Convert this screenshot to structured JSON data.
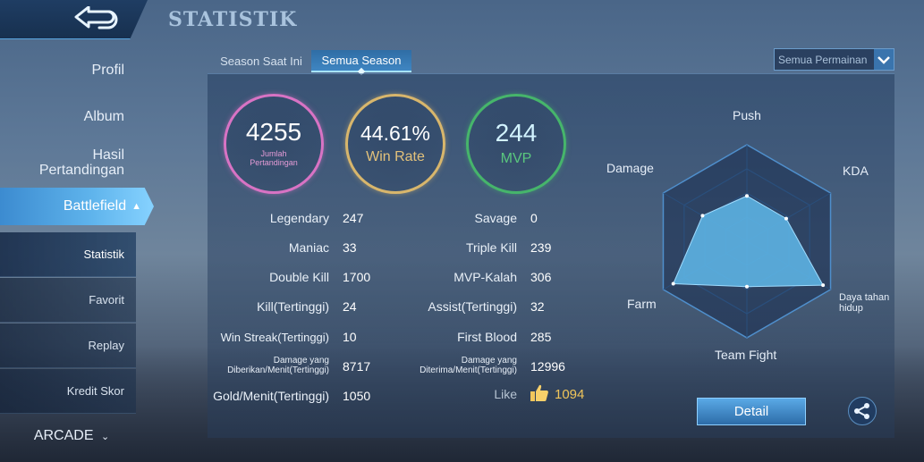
{
  "header": {
    "title": "STATISTIK"
  },
  "sidebar": {
    "items": [
      {
        "label": "Profil"
      },
      {
        "label": "Album"
      },
      {
        "label": "Hasil\nPertandingan"
      }
    ],
    "active": {
      "label": "Battlefield"
    },
    "subitems": [
      {
        "label": "Statistik"
      },
      {
        "label": "Favorit"
      },
      {
        "label": "Replay"
      },
      {
        "label": "Kredit Skor"
      }
    ],
    "arcade": {
      "label": "ARCADE"
    }
  },
  "tabs": [
    {
      "label": "Season Saat Ini"
    },
    {
      "label": "Semua Season"
    }
  ],
  "filter": {
    "selected": "Semua Permainan"
  },
  "summary": {
    "matches": {
      "value": "4255",
      "label": "Jumlah\nPertandingan"
    },
    "winrate": {
      "value": "44.61%",
      "label": "Win Rate"
    },
    "mvp": {
      "value": "244",
      "label": "MVP"
    }
  },
  "stats_left": [
    {
      "label": "Legendary",
      "value": "247"
    },
    {
      "label": "Maniac",
      "value": "33"
    },
    {
      "label": "Double Kill",
      "value": "1700"
    },
    {
      "label": "Kill(Tertinggi)",
      "value": "24"
    },
    {
      "label": "Win Streak(Tertinggi)",
      "value": "10"
    },
    {
      "label": "Damage yang\nDiberikan/Menit(Tertinggi)",
      "value": "8717"
    },
    {
      "label": "Gold/Menit(Tertinggi)",
      "value": "1050"
    }
  ],
  "stats_right": [
    {
      "label": "Savage",
      "value": "0"
    },
    {
      "label": "Triple Kill",
      "value": "239"
    },
    {
      "label": "MVP-Kalah",
      "value": "306"
    },
    {
      "label": "Assist(Tertinggi)",
      "value": "32"
    },
    {
      "label": "First Blood",
      "value": "285"
    },
    {
      "label": "Damage yang\nDiterima/Menit(Tertinggi)",
      "value": "12996"
    }
  ],
  "like": {
    "label": "Like",
    "value": "1094"
  },
  "radar": {
    "axes": [
      "Push",
      "KDA",
      "Daya tahan\nhidup",
      "Team Fight",
      "Farm",
      "Damage"
    ],
    "values": [
      0.47,
      0.47,
      0.91,
      0.47,
      0.88,
      0.53
    ]
  },
  "buttons": {
    "detail": "Detail"
  },
  "colors": {
    "matches_ring": "#d873c4",
    "winrate_ring": "#d8b66c",
    "mvp_ring": "#46b56b",
    "radar_fill": "#5fb9ea",
    "like_value": "#f0c55a"
  },
  "icons": {
    "back": "back-arrow-icon",
    "like": "thumbs-up-icon",
    "share": "share-icon",
    "dropdown": "chevron-down-icon"
  }
}
